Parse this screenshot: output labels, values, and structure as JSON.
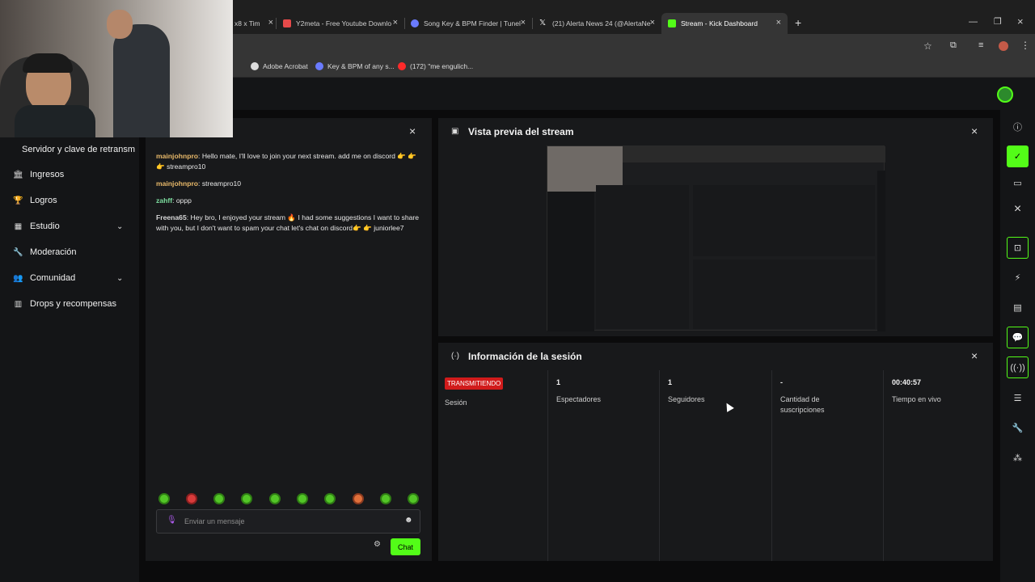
{
  "browser": {
    "tabs": [
      {
        "title": "x8 x Tim",
        "active": false
      },
      {
        "title": "Y2meta - Free Youtube Downlo",
        "active": false
      },
      {
        "title": "Song Key & BPM Finder | Tunel",
        "active": false
      },
      {
        "title": "(21) Alerta News 24 (@AlertaNe",
        "active": false
      },
      {
        "title": "Stream - Kick Dashboard",
        "active": true
      }
    ],
    "new_tab": "+",
    "bookmarks": [
      {
        "label": "Adobe Acrobat"
      },
      {
        "label": "Key & BPM of any s..."
      },
      {
        "label": "(172) \"me engulich..."
      }
    ]
  },
  "sidebar": {
    "items": [
      {
        "label": "Servidor y clave de retransm",
        "icon": "",
        "has_chevron": false
      },
      {
        "label": "Ingresos",
        "icon": "bank-icon",
        "has_chevron": false
      },
      {
        "label": "Logros",
        "icon": "trophy-icon",
        "has_chevron": false
      },
      {
        "label": "Estudio",
        "icon": "studio-icon",
        "has_chevron": true
      },
      {
        "label": "Moderación",
        "icon": "wrench-icon",
        "has_chevron": false
      },
      {
        "label": "Comunidad",
        "icon": "community-icon",
        "has_chevron": true
      },
      {
        "label": "Drops y recompensas",
        "icon": "gift-icon",
        "has_chevron": false
      }
    ]
  },
  "chat": {
    "messages": [
      {
        "user": "mainjohnpro",
        "user_color": "#e8b96a",
        "text": "Hello mate, I'll love to join your next stream. add me on discord 👉 👉 👉 streampro10"
      },
      {
        "user": "mainjohnpro",
        "user_color": "#e8b96a",
        "text": "streampro10"
      },
      {
        "user": "zahff",
        "user_color": "#7ee0a1",
        "text": "oppp"
      },
      {
        "user": "Freena65",
        "user_color": "#d8d8d8",
        "text": "Hey bro, I enjoyed your stream 🔥 I had some suggestions I want to share with you, but I don't want to spam your chat let's chat on discord👉 👉 juniorlee7"
      }
    ],
    "input_placeholder": "Enviar un mensaje",
    "send_label": "Chat"
  },
  "preview": {
    "title": "Vista previa del stream"
  },
  "session": {
    "title": "Información de la sesión",
    "status_badge": "TRANSMITIENDO",
    "status_label": "Sesión",
    "stats": [
      {
        "value": "1",
        "label": "Espectadores"
      },
      {
        "value": "1",
        "label": "Seguidores"
      },
      {
        "value": "-",
        "label": "Cantidad de suscripciones"
      },
      {
        "value": "00:40:57",
        "label": "Tiempo en vivo"
      }
    ]
  },
  "colors": {
    "accent": "#53fc18",
    "badge_red": "#d11b1b",
    "panel_bg": "#18191b",
    "page_bg": "#0b0b0c"
  }
}
